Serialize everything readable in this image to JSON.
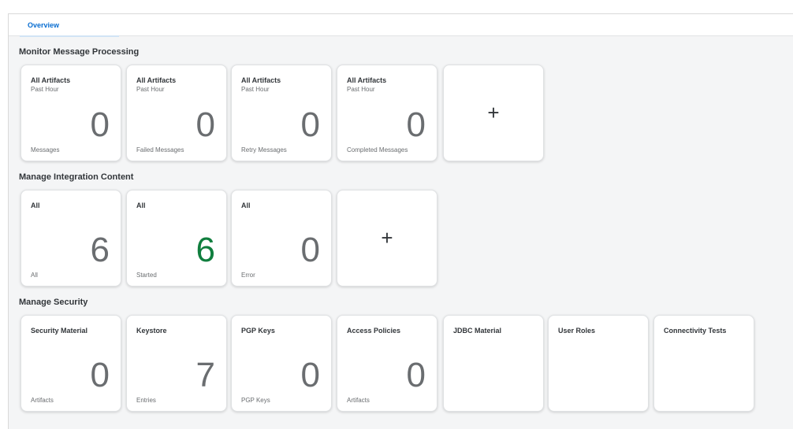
{
  "tabs": [
    {
      "label": "Overview"
    }
  ],
  "sections": {
    "monitor": {
      "title": "Monitor Message Processing",
      "tiles": [
        {
          "title": "All Artifacts",
          "subtitle": "Past Hour",
          "number": "0",
          "footer": "Messages"
        },
        {
          "title": "All Artifacts",
          "subtitle": "Past Hour",
          "number": "0",
          "footer": "Failed Messages"
        },
        {
          "title": "All Artifacts",
          "subtitle": "Past Hour",
          "number": "0",
          "footer": "Retry Messages"
        },
        {
          "title": "All Artifacts",
          "subtitle": "Past Hour",
          "number": "0",
          "footer": "Completed Messages"
        }
      ],
      "add_label": "+"
    },
    "integration": {
      "title": "Manage Integration Content",
      "tiles": [
        {
          "title": "All",
          "number": "6",
          "footer": "All"
        },
        {
          "title": "All",
          "number": "6",
          "footer": "Started",
          "number_color": "#107e3e"
        },
        {
          "title": "All",
          "number": "0",
          "footer": "Error"
        }
      ],
      "add_label": "+"
    },
    "security": {
      "title": "Manage Security",
      "tiles": [
        {
          "title": "Security Material",
          "number": "0",
          "footer": "Artifacts"
        },
        {
          "title": "Keystore",
          "number": "7",
          "footer": "Entries"
        },
        {
          "title": "PGP Keys",
          "number": "0",
          "footer": "PGP Keys"
        },
        {
          "title": "Access Policies",
          "number": "0",
          "footer": "Artifacts"
        },
        {
          "title": "JDBC Material"
        },
        {
          "title": "User Roles"
        },
        {
          "title": "Connectivity Tests"
        }
      ]
    }
  },
  "colors": {
    "accent": "#0a6ed1",
    "positive": "#107e3e",
    "neutral_number": "#6a6d70"
  }
}
